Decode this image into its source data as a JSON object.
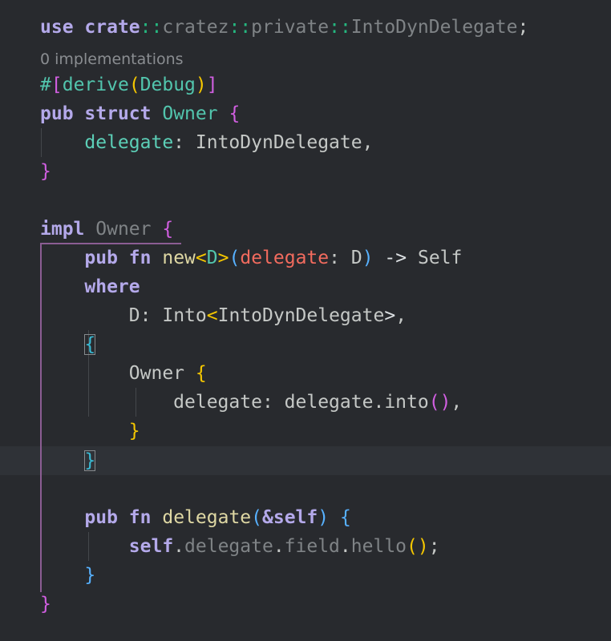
{
  "editor": {
    "codelens": "0 implementations",
    "tok": {
      "use": "use",
      "crate": "crate",
      "cratez": "cratez",
      "private": "private",
      "IntoDynDelegate": "IntoDynDelegate",
      "pathsep": "::",
      "semi": ";",
      "hash": "#",
      "lbracket": "[",
      "rbracket": "]",
      "derive": "derive",
      "lparen": "(",
      "rparen": ")",
      "Debug": "Debug",
      "pub": "pub",
      "struct": "struct",
      "Owner": "Owner",
      "lbrace": "{",
      "rbrace": "}",
      "delegate": "delegate",
      "colon": ":",
      "comma": ",",
      "impl": "impl",
      "fn": "fn",
      "new": "new",
      "lt": "<",
      "gt": ">",
      "D": "D",
      "arrow": "->",
      "Self": "Self",
      "where": "where",
      "Into": "Into",
      "dot": ".",
      "into": "into",
      "amp": "&",
      "self": "self",
      "field": "field",
      "hello": "hello"
    },
    "colors": {
      "background": "#282a2e",
      "keyword": "#b4a9ea",
      "type": "#52c5ad",
      "param": "#f26b5e",
      "function": "#dfd8a4",
      "bracket_magenta": "#d25fe2",
      "bracket_yellow": "#f5c700",
      "bracket_blue": "#57b1ff"
    }
  }
}
